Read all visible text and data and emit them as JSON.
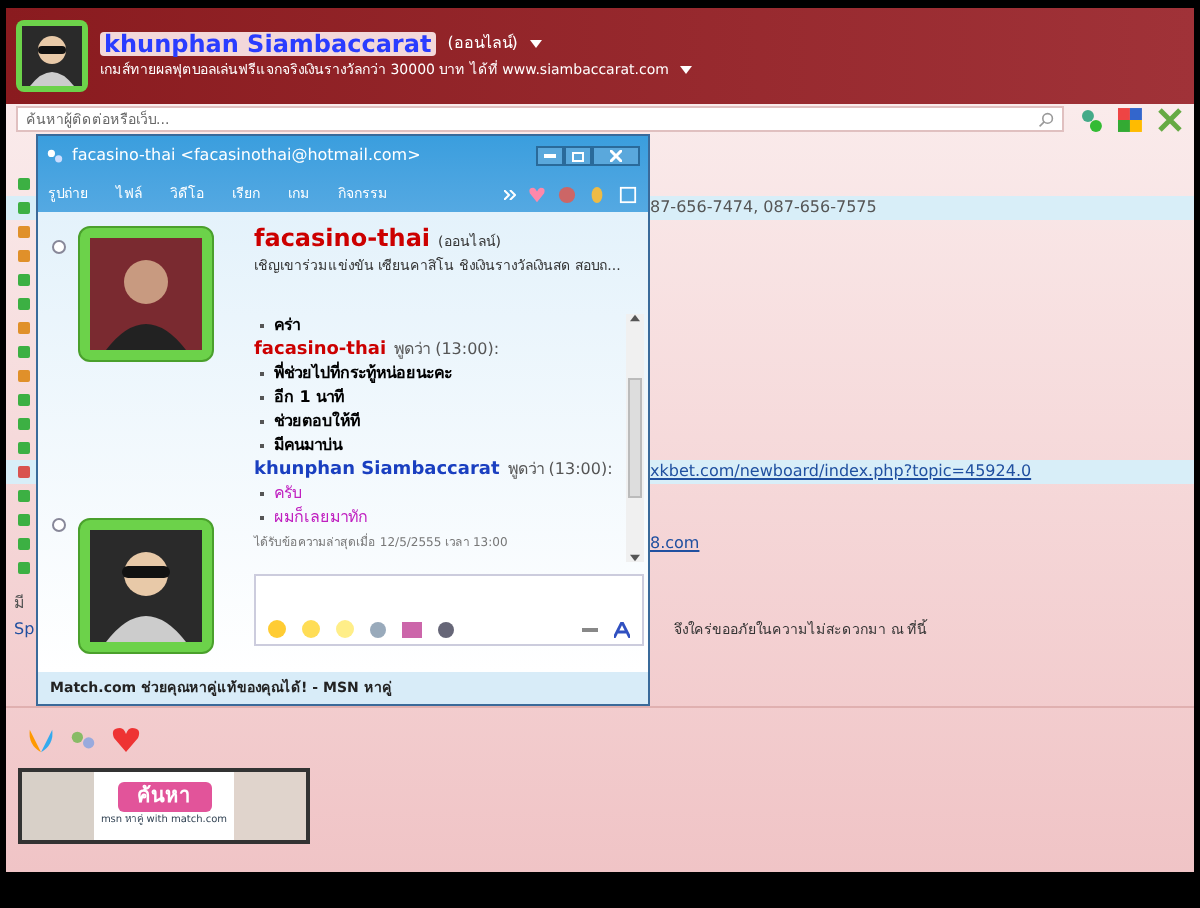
{
  "profile": {
    "name": "khunphan Siambaccarat",
    "status": "(ออนไลน์)",
    "message": "เกมส์ทายผลฟุตบอลเล่นฟรีแจกจริงเงินรางวัลกว่า 30000 บาท ได้ที่ www.siambaccarat.com"
  },
  "search": {
    "placeholder": "ค้นหาผู้ติดต่อหรือเว็บ..."
  },
  "contacts": [
    {
      "color": "#3cb043",
      "selected": false
    },
    {
      "color": "#3cb043",
      "selected": true,
      "text": "87-656-7474,  087-656-7575",
      "kind": "plain"
    },
    {
      "color": "#e0902a",
      "selected": false
    },
    {
      "color": "#e0902a",
      "selected": false
    },
    {
      "color": "#3cb043",
      "selected": false
    },
    {
      "color": "#3cb043",
      "selected": false
    },
    {
      "color": "#e0902a",
      "selected": false
    },
    {
      "color": "#3cb043",
      "selected": false
    },
    {
      "color": "#e0902a",
      "selected": false
    },
    {
      "color": "#3cb043",
      "selected": false
    },
    {
      "color": "#3cb043",
      "selected": false
    },
    {
      "color": "#3cb043",
      "selected": false
    },
    {
      "color": "#d9534f",
      "selected": true,
      "text": "xkbet.com/newboard/index.php?topic=45924.0",
      "kind": "link"
    },
    {
      "color": "#3cb043",
      "selected": false
    },
    {
      "color": "#3cb043",
      "selected": false
    },
    {
      "color": "#3cb043",
      "selected": false,
      "text": "8.com",
      "kind": "link"
    },
    {
      "color": "#3cb043",
      "selected": false
    }
  ],
  "notice": {
    "line_1": "มี",
    "line_2_left": "Sp",
    "line_2_right": "จึงใคร่ขออภัยในความไม่สะดวกมา ณ ที่นี้"
  },
  "banner": {
    "button": "ค้นหา",
    "caption": "msn หาคู่ with match.com"
  },
  "chat": {
    "title": "facasino-thai <facasinothai@hotmail.com>",
    "menu": [
      "รูปถ่าย",
      "ไฟล์",
      "วิดีโอ",
      "เรียก",
      "เกม",
      "กิจกรรม"
    ],
    "contact": {
      "name": "facasino-thai",
      "status": "(ออนไลน์)",
      "message": "เชิญเขาร่วมแข่งขัน เซียนคาสิโน ชิงเงินรางวัลเงินสด  สอบถ..."
    },
    "messages": [
      {
        "kind": "contact",
        "lines": [
          "คร่า"
        ]
      },
      {
        "kind": "contact",
        "sender": "facasino-thai",
        "said": "พูดว่า (13:00):",
        "lines": [
          "พี่ช่วยไปที่กระทู้หน่อยนะคะ",
          "อีก 1 นาที",
          "ช่วยตอบให้ที",
          "มีคนมาบ่น"
        ]
      },
      {
        "kind": "self",
        "sender": "khunphan Siambaccarat",
        "said": "พูดว่า (13:00):",
        "lines": [
          "ครับ",
          "ผมก็เลยมาทัก"
        ]
      }
    ],
    "last_received": "ได้รับข้อความล่าสุดเมื่อ 12/5/2555 เวลา 13:00",
    "status_bar": "Match.com ช่วยคุณหาคู่แท้ของคุณได้! - MSN หาคู่"
  }
}
